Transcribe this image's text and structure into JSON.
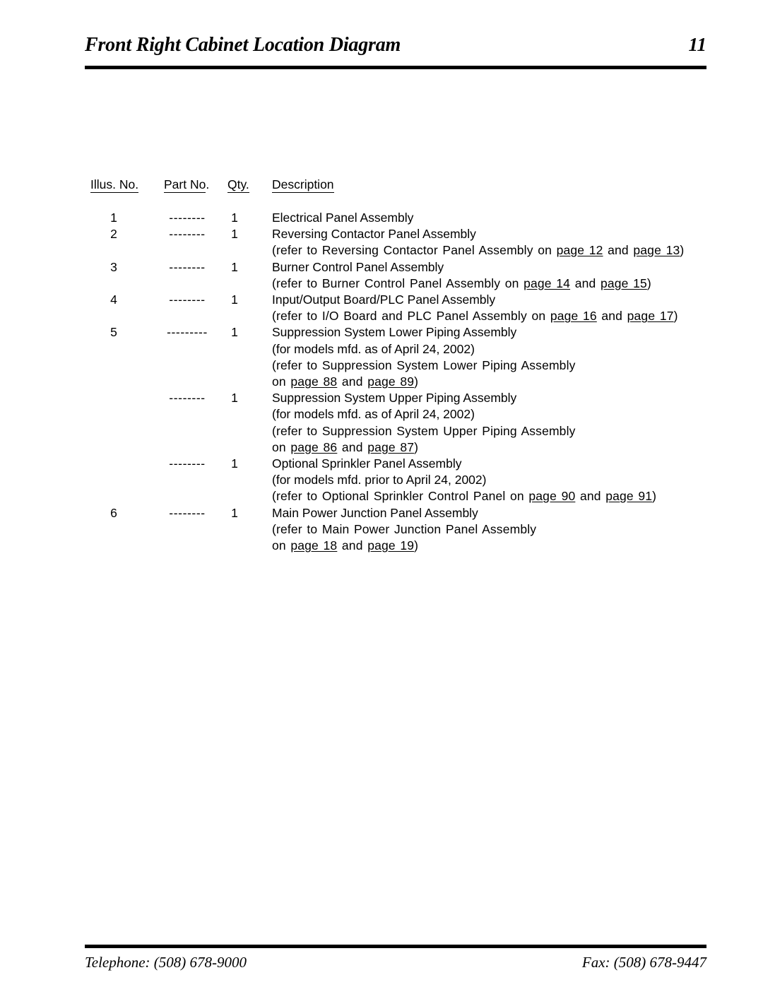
{
  "header": {
    "title": "Front Right Cabinet Location Diagram",
    "page_number": "11"
  },
  "table": {
    "columns": {
      "illus_no": "Illus. No.",
      "part_no_underlined": "Part  No",
      "part_no_tail": ".",
      "qty": "Qty.",
      "description": "Description"
    },
    "rows": [
      {
        "illus_no": "1",
        "part_no": "--------",
        "qty": "1",
        "lines": [
          {
            "text": "Electrical Panel Assembly"
          }
        ]
      },
      {
        "illus_no": "2",
        "part_no": "--------",
        "qty": "1",
        "lines": [
          {
            "text": "Reversing Contactor Panel Assembly"
          },
          {
            "prefix": "(refer to Reversing  Contactor  Panel  Assembly",
            "mid1": " on ",
            "link1": "page  12",
            "mid2": " and ",
            "link2": "page  13",
            "suffix": ")"
          }
        ]
      },
      {
        "illus_no": "3",
        "part_no": "--------",
        "qty": "1",
        "lines": [
          {
            "text": "Burner Control Panel Assembly"
          },
          {
            "prefix": "(refer to Burner  Control  Panel  Assembly",
            "mid1": " on ",
            "link1": "page  14",
            "mid2": " and ",
            "link2": "page  15",
            "suffix": ")"
          }
        ]
      },
      {
        "illus_no": "4",
        "part_no": "--------",
        "qty": "1",
        "lines": [
          {
            "text": "Input/Output Board/PLC Panel Assembly"
          },
          {
            "prefix": "(refer to I/O  Board  and  PLC  Panel  Assembly",
            "mid1": " on ",
            "link1": "page  16",
            "mid2": " and ",
            "link2": "page  17",
            "suffix": ")"
          }
        ]
      },
      {
        "illus_no": "5",
        "part_no": "---------",
        "qty": "1",
        "lines": [
          {
            "text": "Suppression System Lower Piping Assembly"
          },
          {
            "text": "(for models mfd. as of April 24, 2002)"
          },
          {
            "text": "(refer to Suppression  System  Lower  Piping  Assembly"
          },
          {
            "prefix": "on ",
            "link1": "page  88",
            "mid2": " and ",
            "link2": "page  89",
            "suffix": ")"
          }
        ]
      },
      {
        "illus_no": "",
        "part_no": "--------",
        "qty": "1",
        "lines": [
          {
            "text": "Suppression System Upper Piping Assembly"
          },
          {
            "text": "(for models mfd. as of April 24, 2002)"
          },
          {
            "text": "(refer to Suppression  System  Upper  Piping  Assembly"
          },
          {
            "prefix": "on ",
            "link1": "page  86",
            "mid2": " and ",
            "link2": "page  87",
            "suffix": ")"
          }
        ]
      },
      {
        "illus_no": "",
        "part_no": "--------",
        "qty": "1",
        "lines": [
          {
            "text": "Optional Sprinkler Panel Assembly"
          },
          {
            "text": "(for models mfd. prior to April 24, 2002)"
          },
          {
            "prefix": "(refer to Optional  Sprinkler  Control  Panel",
            "mid1": " on ",
            "link1": "page  90",
            "mid2": " and ",
            "link2": "page  91",
            "suffix": ")"
          }
        ]
      },
      {
        "illus_no": "6",
        "part_no": "--------",
        "qty": "1",
        "lines": [
          {
            "text": "Main Power Junction Panel Assembly"
          },
          {
            "text": "(refer to Main  Power  Junction Panel  Assembly"
          },
          {
            "prefix": "on ",
            "link1": "page  18",
            "mid2": " and ",
            "link2": "page  19",
            "suffix": ")"
          }
        ]
      }
    ]
  },
  "footer": {
    "telephone": "Telephone: (508) 678-9000",
    "fax": "Fax: (508) 678-9447"
  }
}
